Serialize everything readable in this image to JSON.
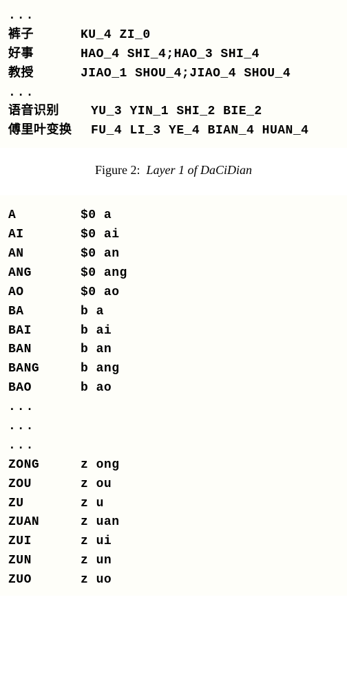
{
  "block1": {
    "rows": [
      {
        "left": "...",
        "right": "",
        "ellipsis": true
      },
      {
        "left": "裤子",
        "right": "KU_4 ZI_0"
      },
      {
        "left": "好事",
        "right": "HAO_4 SHI_4;HAO_3 SHI_4"
      },
      {
        "left": "教授",
        "right": "JIAO_1 SHOU_4;JIAO_4 SHOU_4"
      },
      {
        "left": "...",
        "right": "",
        "ellipsis": true
      },
      {
        "left": "语音识别",
        "right": "YU_3 YIN_1 SHI_2 BIE_2",
        "wide": true
      },
      {
        "left": "傅里叶变换",
        "right": "FU_4 LI_3 YE_4 BIAN_4 HUAN_4",
        "wide": true
      }
    ]
  },
  "caption1": {
    "label": "Figure 2:",
    "text": "Layer 1 of DaCiDian"
  },
  "block2": {
    "rows": [
      {
        "left": "A",
        "right": "$0 a"
      },
      {
        "left": "AI",
        "right": "$0 ai"
      },
      {
        "left": "AN",
        "right": "$0 an"
      },
      {
        "left": "ANG",
        "right": "$0 ang"
      },
      {
        "left": "AO",
        "right": "$0 ao"
      },
      {
        "left": "BA",
        "right": "b a"
      },
      {
        "left": "BAI",
        "right": "b ai"
      },
      {
        "left": "BAN",
        "right": "b an"
      },
      {
        "left": "BANG",
        "right": "b ang"
      },
      {
        "left": "BAO",
        "right": "b ao"
      },
      {
        "left": "...",
        "right": "",
        "ellipsis": true
      },
      {
        "left": "...",
        "right": "",
        "ellipsis": true
      },
      {
        "left": "...",
        "right": "",
        "ellipsis": true
      },
      {
        "left": "ZONG",
        "right": "z ong"
      },
      {
        "left": "ZOU",
        "right": "z ou"
      },
      {
        "left": "ZU",
        "right": "z u"
      },
      {
        "left": "ZUAN",
        "right": "z uan"
      },
      {
        "left": "ZUI",
        "right": "z ui"
      },
      {
        "left": "ZUN",
        "right": "z un"
      },
      {
        "left": "ZUO",
        "right": "z uo"
      }
    ]
  }
}
